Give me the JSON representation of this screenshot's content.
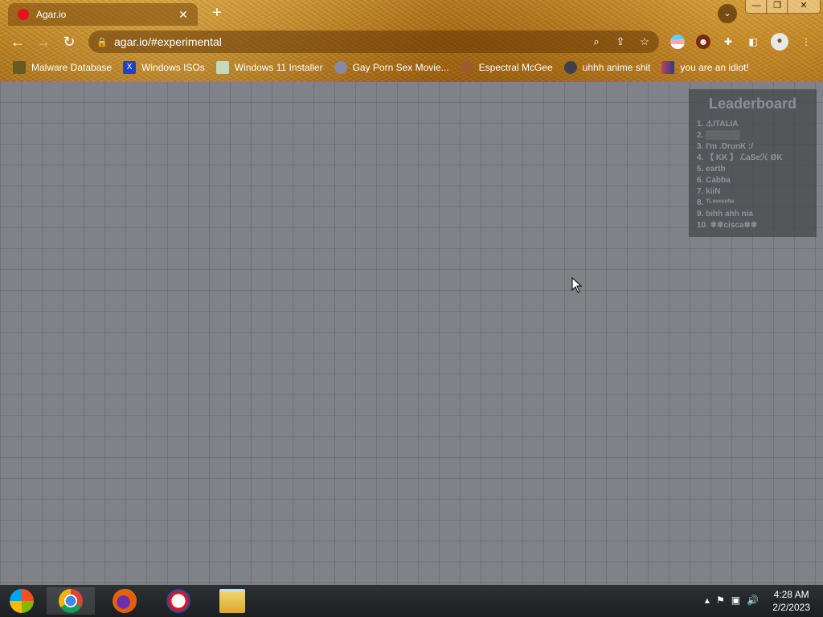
{
  "browser": {
    "tab": {
      "title": "Agar.io",
      "close": "✕"
    },
    "new_tab": "+",
    "tab_search": "⌄",
    "window_controls": {
      "minimize": "—",
      "maximize": "❐",
      "close": "✕"
    },
    "nav": {
      "back": "←",
      "forward": "→",
      "reload": "↻"
    },
    "url": "agar.io/#experimental",
    "lock": "🔒",
    "omnibox_icons": {
      "search": "⌕",
      "share": "⇪",
      "star": "☆"
    },
    "extensions": {
      "avatar": "☻",
      "puzzle": "✚",
      "sidepanel": "◧",
      "profile": "●",
      "menu": "⋮"
    },
    "bookmarks": [
      {
        "label": "Malware Database",
        "icon": "malware-icon",
        "color": "#6a5a20"
      },
      {
        "label": "Windows ISOs",
        "icon": "x-icon",
        "color": "#1f3fd0"
      },
      {
        "label": "Windows 11 Installer",
        "icon": "image-icon",
        "color": "#c8d8b8"
      },
      {
        "label": "Gay Porn Sex Movie...",
        "icon": "disc-icon",
        "color": "#8a8aa0"
      },
      {
        "label": "Espectral McGee",
        "icon": "face-icon",
        "color": "#a05a30"
      },
      {
        "label": "uhhh anime shit",
        "icon": "anime-icon",
        "color": "#404048"
      },
      {
        "label": "you are an idiot!",
        "icon": "flag-icon",
        "color": "#c04060"
      }
    ]
  },
  "game": {
    "leaderboard": {
      "title": "Leaderboard",
      "entries": [
        "1. ⚠ITALIA",
        "2. ▒▒▒▒▒▒",
        "3. I'm .DrunK :/",
        "4. 【 KK 】 ℒaSeℋ ØK",
        "5. earth",
        "6. Cabba",
        "7. kiiN",
        "8. ᵀᴸᵒᵛᵉˢᵒᶠᶦᵃ",
        "9. bihh ahh nia",
        "10. ❄❄cisca❄❄"
      ]
    }
  },
  "taskbar": {
    "apps": [
      {
        "name": "start",
        "color": "#2a7ad0"
      },
      {
        "name": "Google Chrome",
        "color": "#db4437"
      },
      {
        "name": "Firefox",
        "color": "#e66000"
      },
      {
        "name": "Opera",
        "color": "#cc1b2a"
      },
      {
        "name": "File Explorer",
        "color": "#e8c04a"
      }
    ],
    "tray": {
      "chevron": "▴",
      "flag": "⚑",
      "network": "▣",
      "volume": "🔊"
    },
    "clock": {
      "time": "4:28 AM",
      "date": "2/2/2023"
    }
  }
}
